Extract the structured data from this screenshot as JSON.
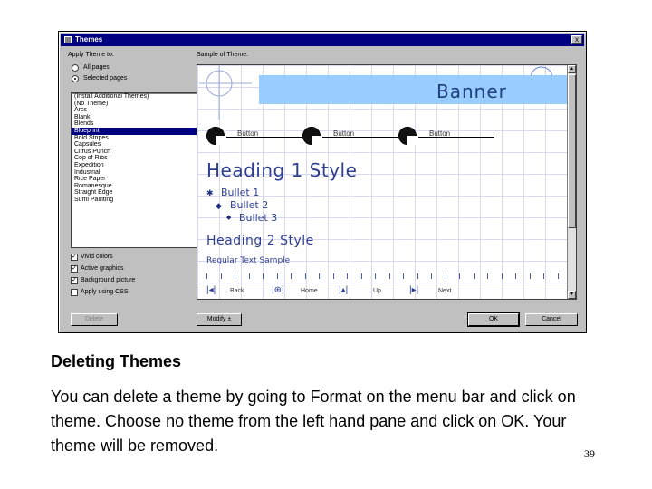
{
  "dialog": {
    "title": "Themes",
    "close_glyph": "x",
    "apply_label": "Apply Theme to:",
    "radio_all": "All pages",
    "radio_selected": "Selected pages",
    "theme_list": [
      "(Install Additional Themes)",
      "(No Theme)",
      "Arcs",
      "Blank",
      "Blends",
      "Blueprint",
      "Bold Stripes",
      "Capsules",
      "Citrus Punch",
      "Cop of Ribs",
      "Expedition",
      "Industrial",
      "Rice Paper",
      "Romanesque",
      "Straight Edge",
      "Sumi Painting"
    ],
    "selected_theme_index": 5,
    "check_vivid": "Vivid colors",
    "check_active": "Active graphics",
    "check_background": "Background picture",
    "check_css": "Apply using CSS",
    "delete_label": "Delete",
    "sample_label": "Sample of Theme:",
    "modify_label": "Modify ±",
    "ok_label": "OK",
    "cancel_label": "Cancel"
  },
  "preview": {
    "banner": "Banner",
    "button": "Button",
    "heading1": "Heading 1 Style",
    "bullet1": "Bullet 1",
    "bullet2": "Bullet 2",
    "bullet3": "Bullet 3",
    "heading2": "Heading 2 Style",
    "regular": "Regular Text Sample",
    "nav_back": "Back",
    "nav_home": "Home",
    "nav_up": "Up",
    "nav_next": "Next"
  },
  "caption": {
    "title": "Deleting Themes",
    "body": "You can delete a theme by going to Format on the menu bar and click on theme. Choose no theme from the left hand pane and click on OK. Your theme will be removed."
  },
  "page_number": "39"
}
